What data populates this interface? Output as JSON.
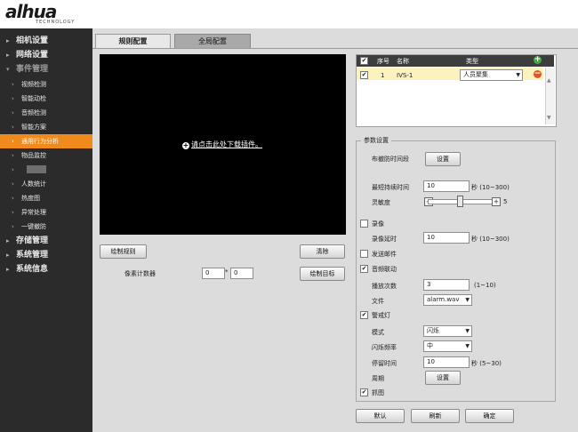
{
  "header": {
    "logo": "alhua",
    "logo_sub": "TECHNOLOGY"
  },
  "sidebar": {
    "items": [
      {
        "label": "相机设置",
        "type": "main",
        "arrow": "▸"
      },
      {
        "label": "网络设置",
        "type": "main",
        "arrow": "▸"
      },
      {
        "label": "事件管理",
        "type": "main",
        "arrow": "▾",
        "state": "expanded"
      },
      {
        "label": "视频检测",
        "type": "sub",
        "arrow": "›"
      },
      {
        "label": "智能动检",
        "type": "sub",
        "arrow": "›"
      },
      {
        "label": "音频检测",
        "type": "sub",
        "arrow": "›"
      },
      {
        "label": "智能方案",
        "type": "sub",
        "arrow": "›"
      },
      {
        "label": "通用行为分析",
        "type": "sub",
        "arrow": "›",
        "state": "active"
      },
      {
        "label": "物品监控",
        "type": "sub",
        "arrow": "›"
      },
      {
        "label": "",
        "type": "sub",
        "arrow": "›",
        "redacted": true
      },
      {
        "label": "人数统计",
        "type": "sub",
        "arrow": "›"
      },
      {
        "label": "热度图",
        "type": "sub",
        "arrow": "›"
      },
      {
        "label": "异常处理",
        "type": "sub",
        "arrow": "›"
      },
      {
        "label": "一键撤防",
        "type": "sub",
        "arrow": "›"
      },
      {
        "label": "存储管理",
        "type": "main",
        "arrow": "▸"
      },
      {
        "label": "系统管理",
        "type": "main",
        "arrow": "▸"
      },
      {
        "label": "系统信息",
        "type": "main",
        "arrow": "▸"
      }
    ],
    "active_color": "#f08a1c"
  },
  "tabs": {
    "rules": "规则配置",
    "global": "全局配置"
  },
  "video": {
    "plugin_text": "请点击此处下载插件。",
    "plugin_icon": "+"
  },
  "controls": {
    "draw_rule": "绘制规则",
    "clear": "清除",
    "pixel_counter_label": "像素计数器",
    "pixel_w": "0",
    "pixel_sep": "*",
    "pixel_h": "0",
    "draw_target": "绘制目标"
  },
  "rule_table": {
    "headers": {
      "index": "序号",
      "name": "名称",
      "type": "类型"
    },
    "rows": [
      {
        "checked": true,
        "index": "1",
        "name": "IVS-1",
        "type": "人员聚集"
      }
    ],
    "add_icon": "+",
    "delete_icon": "−"
  },
  "params": {
    "title": "参数设置",
    "schedule_label": "布撤防时间段",
    "schedule_button": "设置",
    "min_duration_label": "最短持续时间",
    "min_duration_value": "10",
    "min_duration_unit": "秒 (10~300)",
    "sensitivity_label": "灵敏度",
    "sensitivity_value": "5",
    "sensitivity_level": 0.5,
    "record": {
      "checked": false,
      "label": "录像"
    },
    "record_delay_label": "录像延时",
    "record_delay_value": "10",
    "record_delay_unit": "秒 (10~300)",
    "send_email": {
      "checked": false,
      "label": "发送邮件"
    },
    "audio_link": {
      "checked": true,
      "label": "音频联动"
    },
    "play_count_label": "播放次数",
    "play_count_value": "3",
    "play_count_range": "(1~10)",
    "file_label": "文件",
    "file_value": "alarm.wav",
    "warning_light": {
      "checked": true,
      "label": "警戒灯"
    },
    "mode_label": "模式",
    "mode_value": "闪烁",
    "flash_freq_label": "闪烁频率",
    "flash_freq_value": "中",
    "stay_time_label": "停留时间",
    "stay_time_value": "10",
    "stay_time_unit": "秒 (5~30)",
    "period_label": "周期",
    "period_button": "设置",
    "snapshot": {
      "checked": true,
      "label": "抓图"
    }
  },
  "footer": {
    "default": "默认",
    "refresh": "刷新",
    "ok": "确定"
  }
}
